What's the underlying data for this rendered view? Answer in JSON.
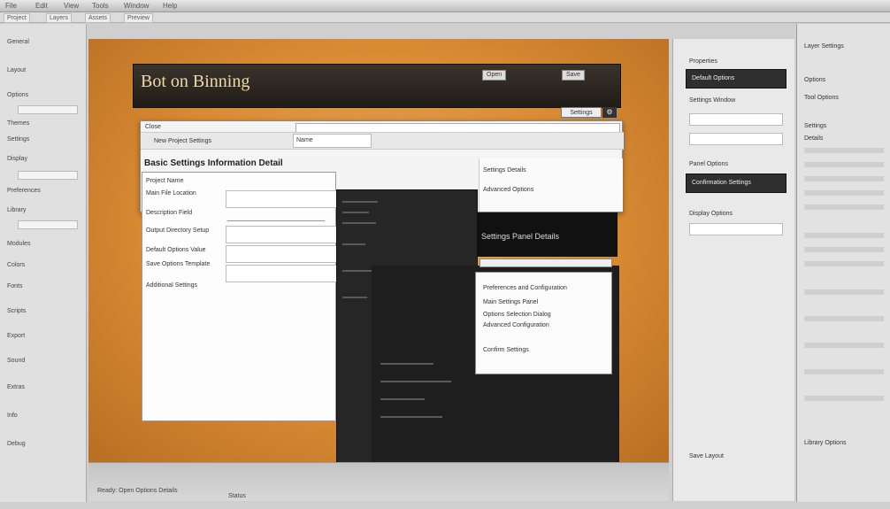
{
  "toolbar": {
    "items": [
      "File",
      "Edit",
      "View",
      "Tools",
      "Window",
      "Help"
    ]
  },
  "tabs": [
    "Project",
    "Layers",
    "Assets",
    "Preview"
  ],
  "left_panel": {
    "items": [
      "General",
      "Layout",
      "Options",
      "Themes",
      "Settings",
      "Display",
      "Preferences",
      "Library",
      "Modules",
      "Colors",
      "Fonts",
      "Scripts",
      "Export",
      "Sound",
      "Extras",
      "Info",
      "Debug"
    ]
  },
  "banner": {
    "title": "Bot on Binning",
    "btn_a": "Open",
    "btn_b": "Save"
  },
  "corner": {
    "button": "Settings",
    "icon": "⚙"
  },
  "dialog": {
    "label": "Close",
    "subhead": "New Project Settings",
    "input2": "Name",
    "heading": "Basic Settings Information Detail",
    "right_items": [
      "Settings Details",
      "Advanced Options"
    ]
  },
  "form": {
    "labels": [
      "Project Name",
      "Main File Location",
      "Description Field",
      "Output Directory Setup",
      "Default Options Value",
      "Save Options Template",
      "Additional Settings"
    ]
  },
  "dark_strip": {
    "title": "Settings Panel Details"
  },
  "right_card": {
    "items": [
      "Preferences and Configuration",
      "Main Settings Panel",
      "Options Selection Dialog",
      "Advanced Configuration",
      "Confirm Settings"
    ]
  },
  "bottom": {
    "text": "Ready: Open Options Details",
    "text2": "Status"
  },
  "right_panel": {
    "labels": [
      "Properties",
      "Settings Window",
      "Panel Options",
      "Display Options",
      "Save Layout"
    ],
    "dark_a": "Default Options",
    "dark_b": "Confirmation Settings"
  },
  "far_right": {
    "labels": [
      "Layer Settings",
      "Options",
      "Tool Options",
      "Settings",
      "Details",
      "Library Options"
    ]
  }
}
